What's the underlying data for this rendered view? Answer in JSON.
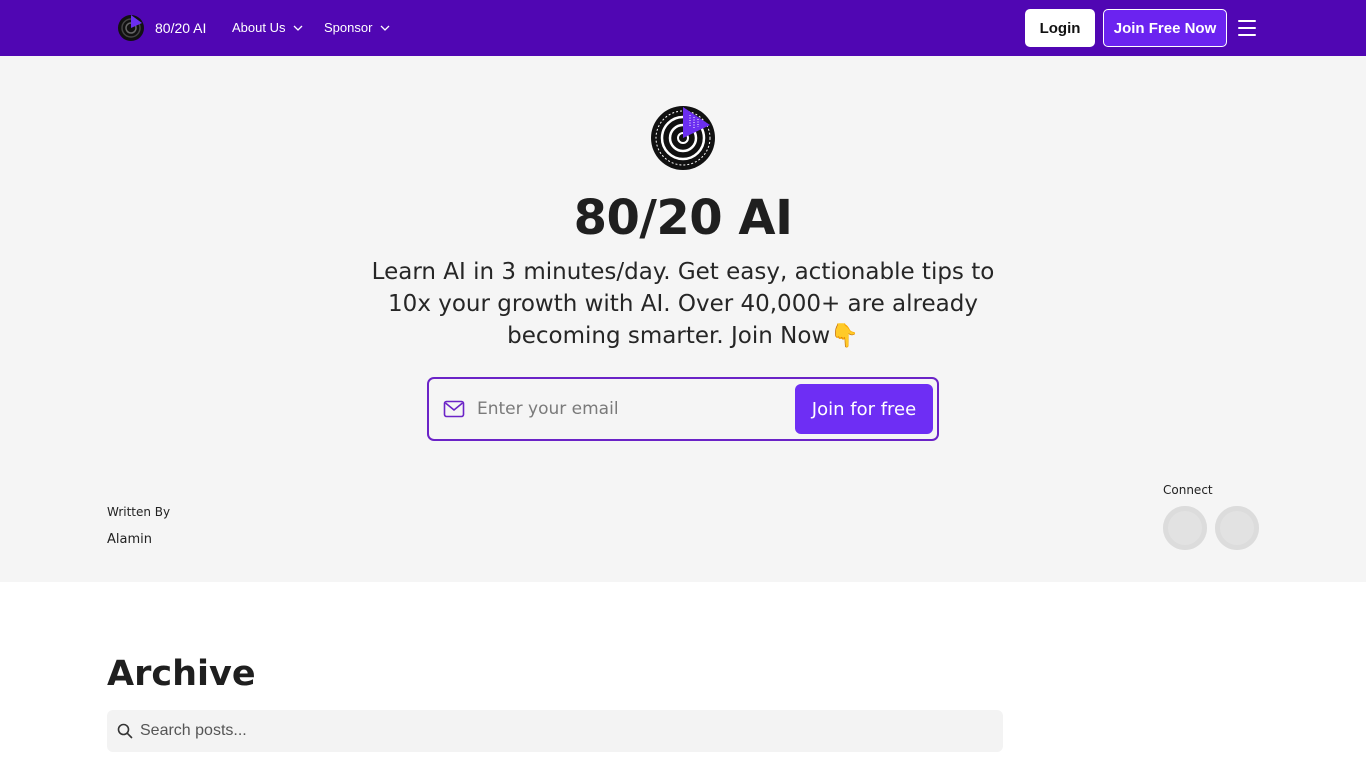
{
  "nav": {
    "brand_name": "80/20 AI",
    "menus": [
      {
        "label": "About Us"
      },
      {
        "label": "Sponsor"
      }
    ],
    "login_label": "Login",
    "join_label": "Join Free Now",
    "menu_icon": "hamburger-icon"
  },
  "hero": {
    "title": "80/20 AI",
    "tagline": "Learn AI in 3 minutes/day. Get easy, actionable tips to 10x your growth with AI. Over 40,000+ are already becoming smarter. Join Now👇",
    "email_placeholder": "Enter your email",
    "email_value": "",
    "email_icon": "mail-icon",
    "join_button": "Join for free",
    "written_by_label": "Written By",
    "author": "Alamin",
    "connect_label": "Connect"
  },
  "archive": {
    "title": "Archive",
    "search_placeholder": "Search posts...",
    "search_icon": "search-icon"
  },
  "colors": {
    "nav_bg": "#5006b3",
    "accent": "#6e2ef4",
    "hero_bg": "#f5f5f5",
    "input_border": "#6b23c7"
  }
}
